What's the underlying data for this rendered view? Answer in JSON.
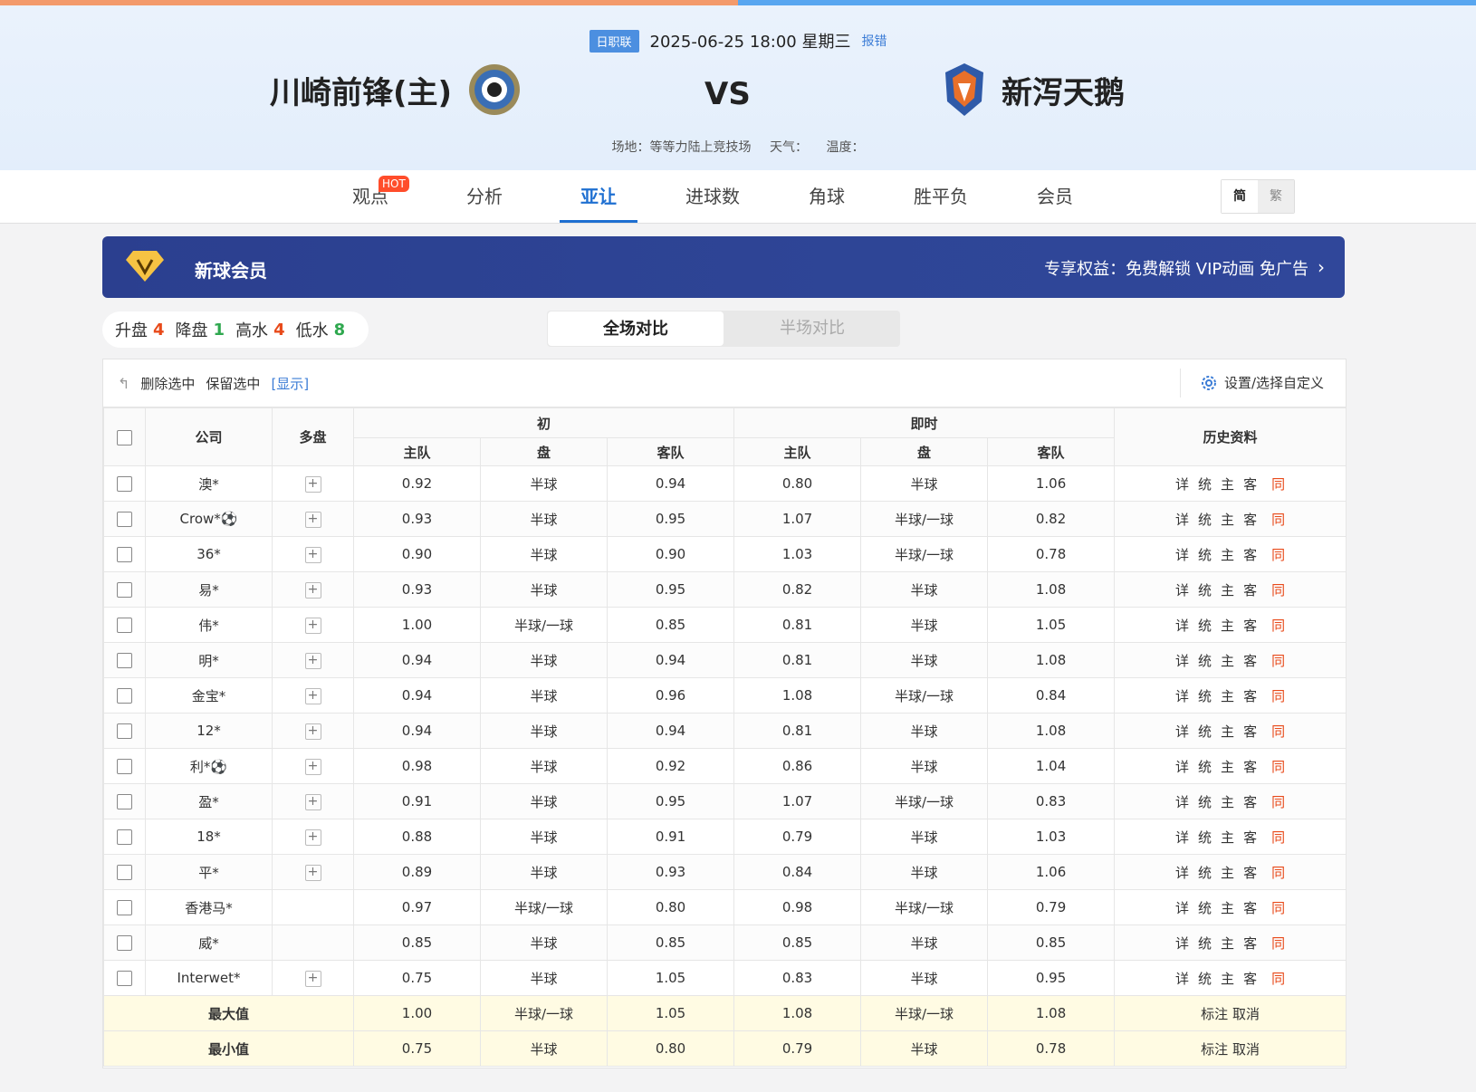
{
  "match": {
    "league": "日职联",
    "datetime": "2025-06-25 18:00 星期三",
    "report": "报错",
    "home_team": "川崎前锋(主)",
    "away_team": "新泻天鹅",
    "vs": "VS",
    "venue": "场地：等等力陆上竞技场",
    "weather": "天气：",
    "temperature": "温度："
  },
  "nav": {
    "tabs": [
      "观点",
      "分析",
      "亚让",
      "进球数",
      "角球",
      "胜平负",
      "会员"
    ],
    "active": "亚让",
    "hot_badge": "HOT",
    "lang_simplified": "简",
    "lang_traditional": "繁"
  },
  "vip": {
    "title": "新球会员",
    "benefit": "专享权益：免费解锁 VIP动画 免广告"
  },
  "stats": {
    "up_label": "升盘",
    "up_value": "4",
    "down_label": "降盘",
    "down_value": "1",
    "high_label": "高水",
    "high_value": "4",
    "low_label": "低水",
    "low_value": "8"
  },
  "compare": {
    "full": "全场对比",
    "half": "半场对比"
  },
  "toolbar": {
    "delete": "删除选中",
    "keep": "保留选中",
    "show": "[显示]",
    "settings": "设置/选择自定义"
  },
  "table": {
    "headers": {
      "company": "公司",
      "multi": "多盘",
      "initial": "初",
      "live": "即时",
      "history": "历史资料",
      "home": "主队",
      "line": "盘",
      "away": "客队"
    },
    "history_links": [
      "详",
      "统",
      "主",
      "客",
      "同"
    ],
    "rows": [
      {
        "company": "澳*",
        "multi": true,
        "ih": "0.92",
        "il": "半球",
        "ia": "0.94",
        "lh": "0.80",
        "ll": "半球",
        "la": "1.06"
      },
      {
        "company": "Crow*⚽",
        "multi": true,
        "ih": "0.93",
        "il": "半球",
        "ia": "0.95",
        "lh": "1.07",
        "ll": "半球/一球",
        "la": "0.82"
      },
      {
        "company": "36*",
        "multi": true,
        "ih": "0.90",
        "il": "半球",
        "ia": "0.90",
        "lh": "1.03",
        "ll": "半球/一球",
        "la": "0.78"
      },
      {
        "company": "易*",
        "multi": true,
        "ih": "0.93",
        "il": "半球",
        "ia": "0.95",
        "lh": "0.82",
        "ll": "半球",
        "la": "1.08"
      },
      {
        "company": "伟*",
        "multi": true,
        "ih": "1.00",
        "il": "半球/一球",
        "ia": "0.85",
        "lh": "0.81",
        "ll": "半球",
        "la": "1.05"
      },
      {
        "company": "明*",
        "multi": true,
        "ih": "0.94",
        "il": "半球",
        "ia": "0.94",
        "lh": "0.81",
        "ll": "半球",
        "la": "1.08"
      },
      {
        "company": "金宝*",
        "multi": true,
        "ih": "0.94",
        "il": "半球",
        "ia": "0.96",
        "lh": "1.08",
        "ll": "半球/一球",
        "la": "0.84"
      },
      {
        "company": "12*",
        "multi": true,
        "ih": "0.94",
        "il": "半球",
        "ia": "0.94",
        "lh": "0.81",
        "ll": "半球",
        "la": "1.08"
      },
      {
        "company": "利*⚽",
        "multi": true,
        "ih": "0.98",
        "il": "半球",
        "ia": "0.92",
        "lh": "0.86",
        "ll": "半球",
        "la": "1.04"
      },
      {
        "company": "盈*",
        "multi": true,
        "ih": "0.91",
        "il": "半球",
        "ia": "0.95",
        "lh": "1.07",
        "ll": "半球/一球",
        "la": "0.83"
      },
      {
        "company": "18*",
        "multi": true,
        "ih": "0.88",
        "il": "半球",
        "ia": "0.91",
        "lh": "0.79",
        "ll": "半球",
        "la": "1.03"
      },
      {
        "company": "平*",
        "multi": true,
        "ih": "0.89",
        "il": "半球",
        "ia": "0.93",
        "lh": "0.84",
        "ll": "半球",
        "la": "1.06"
      },
      {
        "company": "香港马*",
        "multi": false,
        "ih": "0.97",
        "il": "半球/一球",
        "ia": "0.80",
        "lh": "0.98",
        "ll": "半球/一球",
        "la": "0.79"
      },
      {
        "company": "威*",
        "multi": false,
        "ih": "0.85",
        "il": "半球",
        "ia": "0.85",
        "lh": "0.85",
        "ll": "半球",
        "la": "0.85"
      },
      {
        "company": "Interwet*",
        "multi": true,
        "ih": "0.75",
        "il": "半球",
        "ia": "1.05",
        "lh": "0.83",
        "ll": "半球",
        "la": "0.95"
      }
    ],
    "max": {
      "label": "最大值",
      "ih": "1.00",
      "il": "半球/一球",
      "ia": "1.05",
      "lh": "1.08",
      "ll": "半球/一球",
      "la": "1.08",
      "mark": "标注",
      "cancel": "取消"
    },
    "min": {
      "label": "最小值",
      "ih": "0.75",
      "il": "半球",
      "ia": "0.80",
      "lh": "0.79",
      "ll": "半球",
      "la": "0.78",
      "mark": "标注",
      "cancel": "取消"
    }
  },
  "colors": {
    "accent": "#1e6fd1",
    "up": "#e84a1a",
    "down": "#2fa84f",
    "vip_bg": "#2e4596"
  }
}
